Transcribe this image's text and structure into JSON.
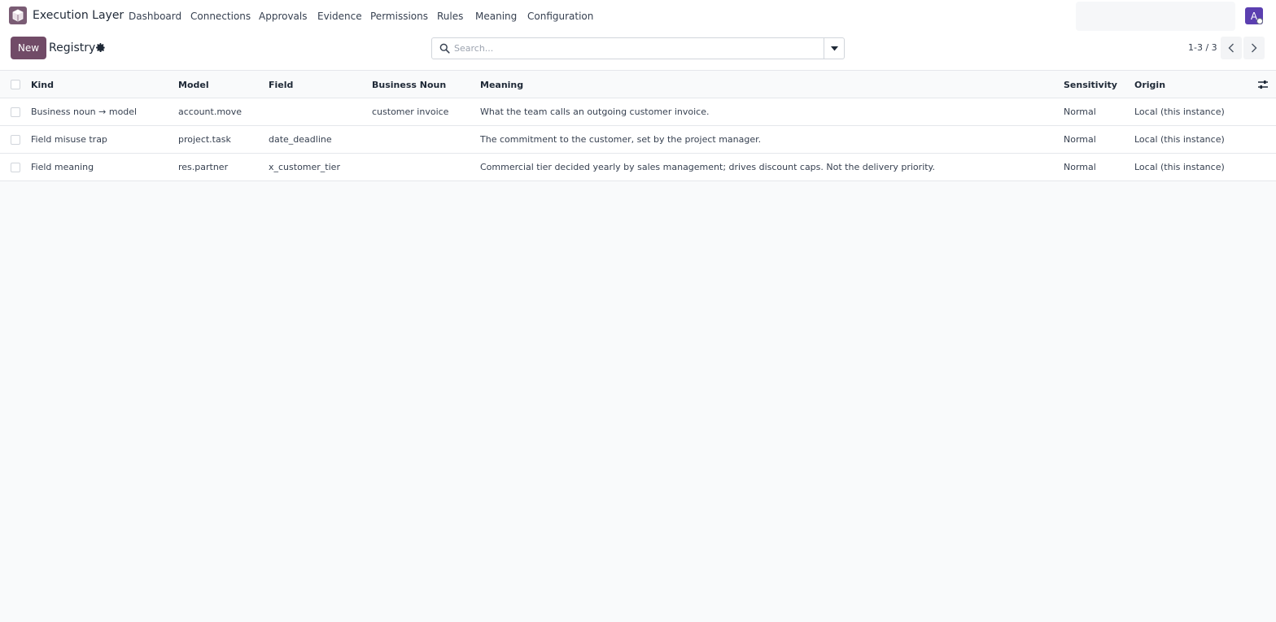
{
  "navbar": {
    "app_name": "Execution Layer",
    "menu": [
      "Dashboard",
      "Connections",
      "Approvals",
      "Evidence",
      "Permissions",
      "Rules",
      "Meaning",
      "Configuration"
    ],
    "avatar_letter": "A",
    "accent_color": "#714b67",
    "avatar_color": "#5b3fb0"
  },
  "control_panel": {
    "new_label": "New",
    "title": "Registry",
    "search_placeholder": "Search...",
    "pager": "1-3 / 3"
  },
  "table": {
    "columns": [
      "Kind",
      "Model",
      "Field",
      "Business Noun",
      "Meaning",
      "Sensitivity",
      "Origin"
    ],
    "rows": [
      {
        "kind": "Business noun → model",
        "model": "account.move",
        "field": "",
        "noun": "customer invoice",
        "meaning": "What the team calls an outgoing customer invoice.",
        "sensitivity": "Normal",
        "origin": "Local (this instance)"
      },
      {
        "kind": "Field misuse trap",
        "model": "project.task",
        "field": "date_deadline",
        "noun": "",
        "meaning": "The commitment to the customer, set by the project manager.",
        "sensitivity": "Normal",
        "origin": "Local (this instance)"
      },
      {
        "kind": "Field meaning",
        "model": "res.partner",
        "field": "x_customer_tier",
        "noun": "",
        "meaning": "Commercial tier decided yearly by sales management; drives discount caps. Not the delivery priority.",
        "sensitivity": "Normal",
        "origin": "Local (this instance)"
      }
    ]
  }
}
